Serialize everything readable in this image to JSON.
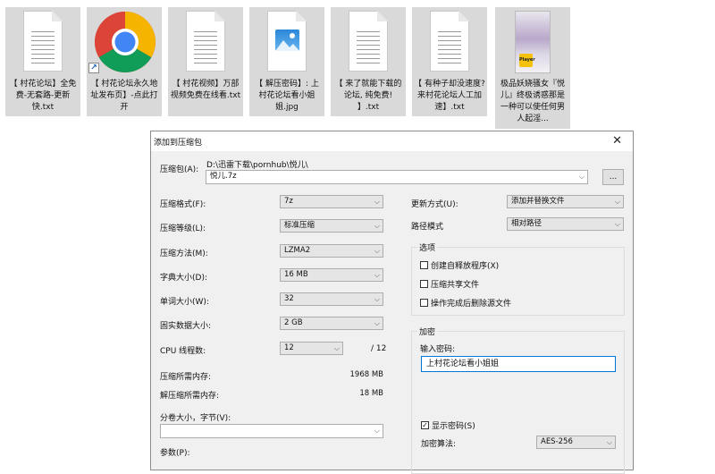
{
  "desktop": {
    "files": [
      {
        "name": "【 村花论坛】全免费-无套路-更新快.txt",
        "kind": "txt"
      },
      {
        "name": "【 村花论坛永久地址发布页】-点此打开",
        "kind": "chrome-shortcut"
      },
      {
        "name": "【 村花视频】万部视频免费在线看.txt",
        "kind": "txt"
      },
      {
        "name": "【 解压密码】: 上村花论坛看小姐姐.jpg",
        "kind": "jpg"
      },
      {
        "name": "【 来了就能下载的论坛, 纯免费! 】.txt",
        "kind": "txt"
      },
      {
        "name": "【 有种子却没速度? 来村花论坛人工加速】.txt",
        "kind": "txt"
      },
      {
        "name": "极品妖娆骚女『悦儿』终极诱惑那是一种可以使任何男人起淫...",
        "kind": "video",
        "badge": "Player"
      }
    ]
  },
  "dialog": {
    "title": "添加到压缩包",
    "close": "✕",
    "archive_label": "压缩包(A):",
    "archive_path": "D:\\迅雷下载\\pornhub\\悦儿\\",
    "archive_name": "悦儿.7z",
    "browse_label": "...",
    "left": {
      "format": {
        "label": "压缩格式(F):",
        "value": "7z"
      },
      "level": {
        "label": "压缩等级(L):",
        "value": "标准压缩"
      },
      "method": {
        "label": "压缩方法(M):",
        "value": "LZMA2"
      },
      "dict": {
        "label": "字典大小(D):",
        "value": "16 MB"
      },
      "word": {
        "label": "单词大小(W):",
        "value": "32"
      },
      "solid": {
        "label": "固实数据大小:",
        "value": "2 GB"
      },
      "threads": {
        "label": "CPU 线程数:",
        "value": "12",
        "total": "/ 12"
      },
      "mem_compress": {
        "label": "压缩所需内存:",
        "value": "1968 MB"
      },
      "mem_decompress": {
        "label": "解压缩所需内存:",
        "value": "18 MB"
      },
      "split": {
        "label": "分卷大小，字节(V):",
        "value": ""
      },
      "params": {
        "label": "参数(P):"
      }
    },
    "right": {
      "update": {
        "label": "更新方式(U):",
        "value": "添加并替换文件"
      },
      "path_mode": {
        "label": "路径模式",
        "value": "相对路径"
      },
      "options": {
        "title": "选项",
        "sfx": "创建自释放程序(X)",
        "shared": "压缩共享文件",
        "delete": "操作完成后删除源文件"
      },
      "encryption": {
        "title": "加密",
        "password_label": "输入密码:",
        "password_value": "上村花论坛看小姐姐",
        "show_password": "显示密码(S)",
        "show_password_mark": "✓",
        "method_label": "加密算法:",
        "method_value": "AES-256"
      }
    }
  }
}
